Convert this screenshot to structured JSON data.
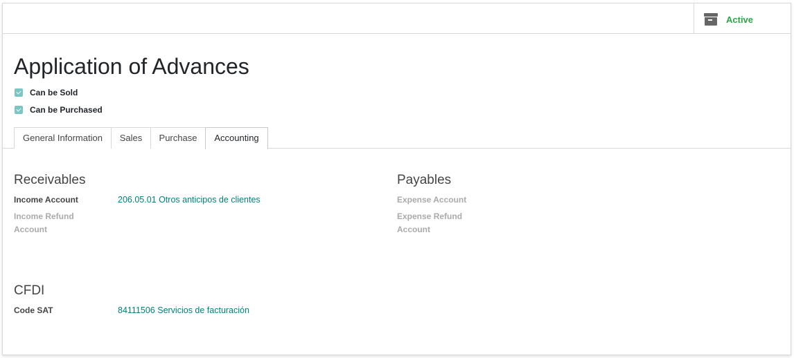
{
  "status_button": {
    "label": "Active",
    "icon": "archive-icon",
    "color": "#28a745"
  },
  "product": {
    "name": "Application of Advances",
    "can_be_sold": {
      "label": "Can be Sold",
      "checked": true
    },
    "can_be_purchased": {
      "label": "Can be Purchased",
      "checked": true
    }
  },
  "tabs": [
    {
      "label": "General Information",
      "active": false
    },
    {
      "label": "Sales",
      "active": false
    },
    {
      "label": "Purchase",
      "active": false
    },
    {
      "label": "Accounting",
      "active": true
    }
  ],
  "receivables": {
    "title": "Receivables",
    "income_account_label": "Income Account",
    "income_account_value": "206.05.01 Otros anticipos de clientes",
    "income_refund_label_1": "Income Refund",
    "income_refund_label_2": "Account"
  },
  "payables": {
    "title": "Payables",
    "expense_account_label": "Expense Account",
    "expense_refund_label_1": "Expense Refund",
    "expense_refund_label_2": "Account"
  },
  "cfdi": {
    "title": "CFDI",
    "code_sat_label": "Code SAT",
    "code_sat_value": "84111506 Servicios de facturación"
  },
  "colors": {
    "link": "#00807a",
    "checkbox": "#7cc5c5",
    "active": "#28a745"
  }
}
